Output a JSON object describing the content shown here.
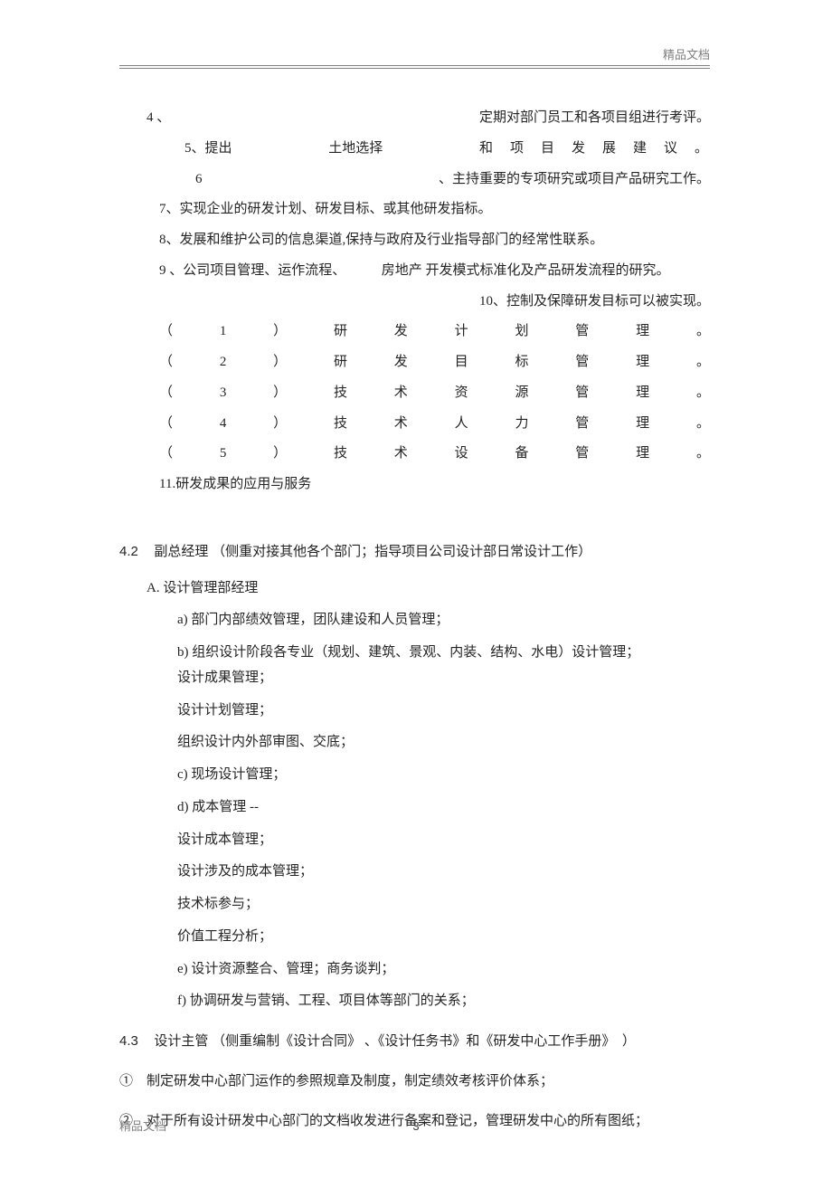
{
  "header": {
    "label": "精品文档"
  },
  "footer": {
    "label": "精品文档",
    "page": "3"
  },
  "sec1": {
    "l4": {
      "num": "4 、",
      "tail": "定期对部门员工和各项目组进行考评。"
    },
    "l5": {
      "pre": "5、提出",
      "mid": "土地选择",
      "tail": "和　项　目　发　展　建　议　。"
    },
    "l6": {
      "num": "6",
      "tail": "、主持重要的专项研究或项目产品研究工作。"
    },
    "l7": "7、实现企业的研发计划、研发目标、或其他研发指标。",
    "l8": "8、发展和维护公司的信息渠道,保持与政府及行业指导部门的经常性联系。",
    "l9": {
      "a": "9 、公司项目管理、运作流程、",
      "b": "房地产 开发模式标准化及产品研发流程的研究。"
    },
    "l10": "10、控制及保障研发目标可以被实现。",
    "rows": [
      [
        "（",
        "1",
        "）",
        "研",
        "发",
        "计",
        "划",
        "管",
        "理",
        "。"
      ],
      [
        "（",
        "2",
        "）",
        "研",
        "发",
        "目",
        "标",
        "管",
        "理",
        "。"
      ],
      [
        "（",
        "3",
        "）",
        "技",
        "术",
        "资",
        "源",
        "管",
        "理",
        "。"
      ],
      [
        "（",
        "4",
        "）",
        "技",
        "术",
        "人",
        "力",
        "管",
        "理",
        "。"
      ],
      [
        "（",
        "5",
        "）",
        "技",
        "术",
        "设",
        "备",
        "管",
        "理",
        "。"
      ]
    ],
    "l11": "11.研发成果的应用与服务"
  },
  "sec4_2": {
    "head_num": "4.2",
    "head_txt": "副总经理 （侧重对接其他各个部门；指导项目公司设计部日常设计工作）",
    "A": "A. 设计管理部经理",
    "a": "a) 部门内部绩效管理，团队建设和人员管理；",
    "b1": "b) 组织设计阶段各专业（规划、建筑、景观、内装、结构、水电）设计管理；",
    "b2": "设计成果管理；",
    "b3": "设计计划管理；",
    "b4": "组织设计内外部审图、交底；",
    "c": "c) 现场设计管理；",
    "d1": "d) 成本管理 --",
    "d2": "设计成本管理；",
    "d3": "设计涉及的成本管理；",
    "d4": "技术标参与；",
    "d5": "价值工程分析；",
    "e": "e) 设计资源整合、管理；商务谈判；",
    "f": "f) 协调研发与营销、工程、项目体等部门的关系；"
  },
  "sec4_3": {
    "head_num": "4.3",
    "head_txt": "设计主管 （侧重编制《设计合同》 、《设计任务书》和《研发中心工作手册》　）",
    "i1": "①　制定研发中心部门运作的参照规章及制度，制定绩效考核评价体系；",
    "i2": "②　对于所有设计研发中心部门的文档收发进行备案和登记，管理研发中心的所有图纸；"
  }
}
